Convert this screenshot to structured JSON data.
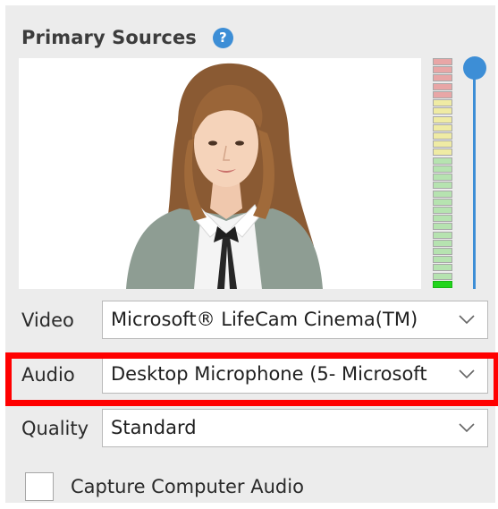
{
  "panel": {
    "title": "Primary Sources",
    "help_icon_glyph": "?",
    "help_icon": "question-circle-icon"
  },
  "video_preview": {
    "content": "webcam-preview-woman-speaking"
  },
  "audio_meter": {
    "segments_top_to_bottom": [
      "red",
      "red",
      "red",
      "red",
      "red",
      "yellow",
      "yellow",
      "yellow",
      "yellow",
      "yellow",
      "yellow",
      "yellow",
      "green",
      "green",
      "green",
      "green",
      "green",
      "green",
      "green",
      "green",
      "green",
      "green",
      "green",
      "green",
      "green",
      "green",
      "green",
      "active-green"
    ],
    "colors": {
      "red": "#e8a6a6",
      "yellow": "#efeba4",
      "green": "#b6e3b0",
      "active-green": "#22d51c"
    }
  },
  "volume_slider": {
    "level": 1.0,
    "color": "#3d8ed6"
  },
  "fields": {
    "video": {
      "label": "Video",
      "value": "Microsoft® LifeCam Cinema(TM)"
    },
    "audio": {
      "label": "Audio",
      "value": "Desktop Microphone (5- Microsoft"
    },
    "quality": {
      "label": "Quality",
      "value": "Standard"
    }
  },
  "capture_audio": {
    "label": "Capture Computer Audio",
    "checked": false
  },
  "colors": {
    "accent": "#3d8ed6",
    "highlight": "#ff0000",
    "panel_bg": "#ececec"
  }
}
